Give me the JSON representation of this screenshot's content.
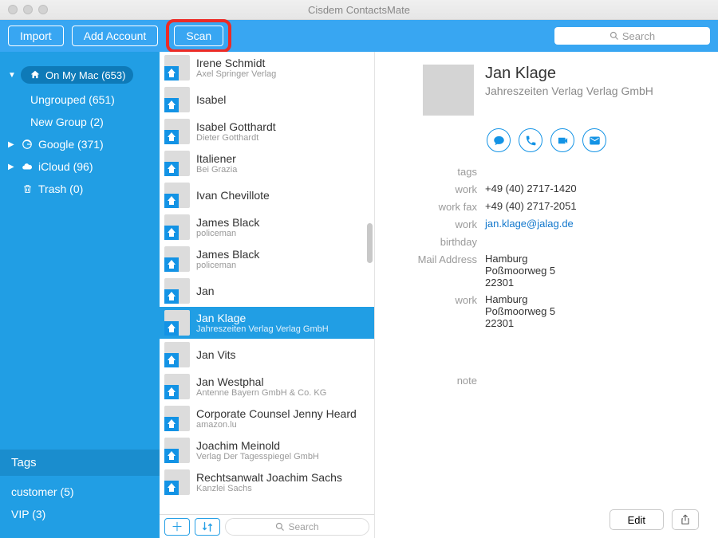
{
  "window": {
    "title": "Cisdem ContactsMate"
  },
  "toolbar": {
    "import": "Import",
    "add_account": "Add Account",
    "scan": "Scan",
    "search_placeholder": "Search"
  },
  "sidebar": {
    "accounts": [
      {
        "label": "On My Mac (653)",
        "icon": "home",
        "expanded": true,
        "active": true,
        "children": [
          {
            "label": "Ungrouped (651)"
          },
          {
            "label": "New Group (2)"
          }
        ]
      },
      {
        "label": "Google (371)",
        "icon": "google",
        "expanded": false
      },
      {
        "label": "iCloud (96)",
        "icon": "cloud",
        "expanded": false
      },
      {
        "label": "Trash (0)",
        "icon": "trash",
        "expanded": false,
        "no_arrow": true
      }
    ],
    "tags_header": "Tags",
    "tags": [
      {
        "label": "customer (5)"
      },
      {
        "label": "VIP (3)"
      }
    ]
  },
  "contacts": {
    "items": [
      {
        "name": "Irene Schmidt",
        "sub": "Axel Springer Verlag"
      },
      {
        "name": "Isabel",
        "sub": ""
      },
      {
        "name": "Isabel Gotthardt",
        "sub": "Dieter Gotthardt"
      },
      {
        "name": "Italiener",
        "sub": "Bei Grazia"
      },
      {
        "name": "Ivan Chevillote",
        "sub": ""
      },
      {
        "name": "James Black",
        "sub": "policeman"
      },
      {
        "name": "James Black",
        "sub": "policeman"
      },
      {
        "name": "Jan",
        "sub": ""
      },
      {
        "name": "Jan Klage",
        "sub": "Jahreszeiten Verlag Verlag GmbH",
        "selected": true
      },
      {
        "name": "Jan Vits",
        "sub": ""
      },
      {
        "name": "Jan Westphal",
        "sub": "Antenne Bayern GmbH & Co. KG"
      },
      {
        "name": "Corporate Counsel Jenny Heard",
        "sub": "amazon.lu"
      },
      {
        "name": "Joachim Meinold",
        "sub": "Verlag Der Tagesspiegel GmbH"
      },
      {
        "name": "Rechtsanwalt Joachim Sachs",
        "sub": "Kanzlei Sachs"
      }
    ],
    "search_placeholder": "Search"
  },
  "detail": {
    "name": "Jan Klage",
    "org": "Jahreszeiten Verlag Verlag GmbH",
    "fields": [
      {
        "label": "tags",
        "value": ""
      },
      {
        "label": "work",
        "value": "+49 (40) 2717-1420"
      },
      {
        "label": "work fax",
        "value": "+49 (40) 2717-2051"
      },
      {
        "label": "work",
        "value": "jan.klage@jalag.de",
        "link": true
      },
      {
        "label": "birthday",
        "value": ""
      },
      {
        "label": "Mail Address",
        "value": "Hamburg\nPoßmoorweg 5\n22301"
      },
      {
        "label": "work",
        "value": "Hamburg\nPoßmoorweg 5\n22301"
      }
    ],
    "note_label": "note",
    "edit_label": "Edit"
  }
}
